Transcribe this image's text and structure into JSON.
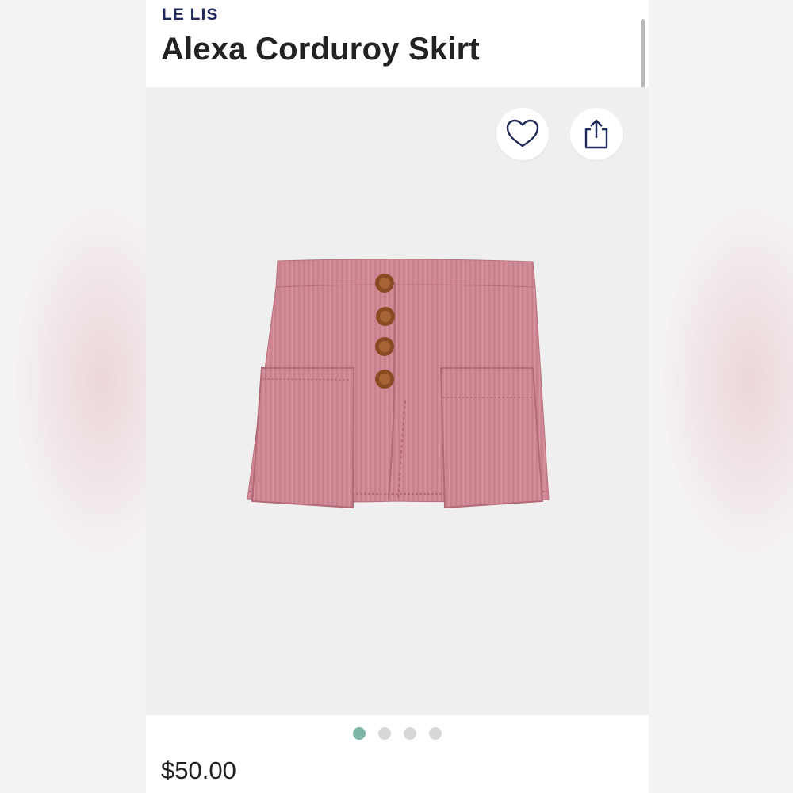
{
  "product": {
    "brand": "LE LIS",
    "title": "Alexa Corduroy Skirt",
    "price": "$50.00",
    "image_alt": "Pink corduroy mini skirt with four buttons and two front patch pockets"
  },
  "gallery": {
    "total_images": 4,
    "active_index": 0
  },
  "actions": {
    "favorite_icon": "heart-icon",
    "share_icon": "share-icon"
  },
  "colors": {
    "brand": "#1f2a5a",
    "active_dot": "#7ab5a6",
    "inactive_dot": "#d7d7d9",
    "skirt": "#d18b95"
  }
}
